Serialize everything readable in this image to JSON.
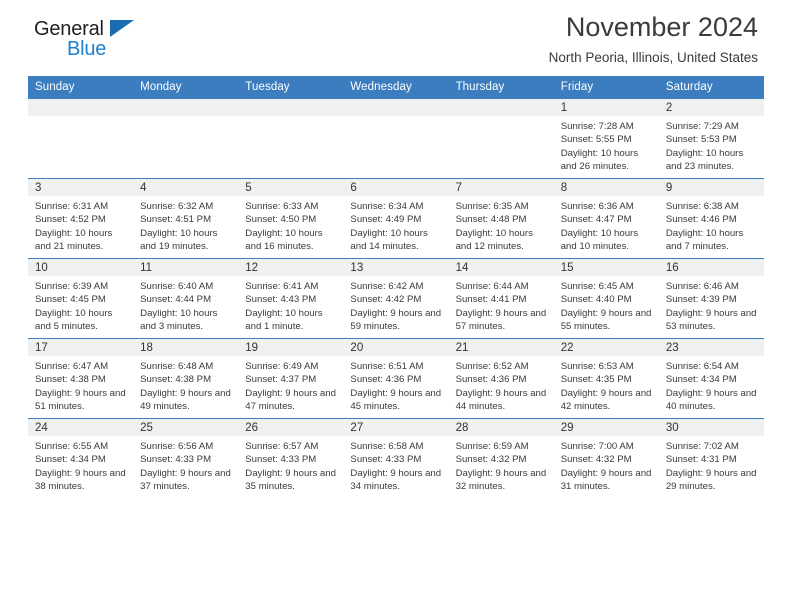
{
  "brand": {
    "name_top": "General",
    "name_bottom": "Blue",
    "triangle_color": "#1b6cb3",
    "blue_text_color": "#1b7fd4"
  },
  "header": {
    "title": "November 2024",
    "subtitle": "North Peoria, Illinois, United States"
  },
  "theme": {
    "header_row_bg": "#3b7dbf",
    "header_row_text": "#ffffff",
    "daynum_band_bg": "#f0f0f0",
    "row_border": "#3b7dbf",
    "body_text": "#3a3a3a"
  },
  "columns": [
    "Sunday",
    "Monday",
    "Tuesday",
    "Wednesday",
    "Thursday",
    "Friday",
    "Saturday"
  ],
  "labels": {
    "sunrise": "Sunrise:",
    "sunset": "Sunset:",
    "daylight": "Daylight:"
  },
  "weeks": [
    [
      {
        "day": "",
        "empty": true
      },
      {
        "day": "",
        "empty": true
      },
      {
        "day": "",
        "empty": true
      },
      {
        "day": "",
        "empty": true
      },
      {
        "day": "",
        "empty": true
      },
      {
        "day": "1",
        "sunrise": "Sunrise: 7:28 AM",
        "sunset": "Sunset: 5:55 PM",
        "daylight": "Daylight: 10 hours and 26 minutes."
      },
      {
        "day": "2",
        "sunrise": "Sunrise: 7:29 AM",
        "sunset": "Sunset: 5:53 PM",
        "daylight": "Daylight: 10 hours and 23 minutes."
      }
    ],
    [
      {
        "day": "3",
        "sunrise": "Sunrise: 6:31 AM",
        "sunset": "Sunset: 4:52 PM",
        "daylight": "Daylight: 10 hours and 21 minutes."
      },
      {
        "day": "4",
        "sunrise": "Sunrise: 6:32 AM",
        "sunset": "Sunset: 4:51 PM",
        "daylight": "Daylight: 10 hours and 19 minutes."
      },
      {
        "day": "5",
        "sunrise": "Sunrise: 6:33 AM",
        "sunset": "Sunset: 4:50 PM",
        "daylight": "Daylight: 10 hours and 16 minutes."
      },
      {
        "day": "6",
        "sunrise": "Sunrise: 6:34 AM",
        "sunset": "Sunset: 4:49 PM",
        "daylight": "Daylight: 10 hours and 14 minutes."
      },
      {
        "day": "7",
        "sunrise": "Sunrise: 6:35 AM",
        "sunset": "Sunset: 4:48 PM",
        "daylight": "Daylight: 10 hours and 12 minutes."
      },
      {
        "day": "8",
        "sunrise": "Sunrise: 6:36 AM",
        "sunset": "Sunset: 4:47 PM",
        "daylight": "Daylight: 10 hours and 10 minutes."
      },
      {
        "day": "9",
        "sunrise": "Sunrise: 6:38 AM",
        "sunset": "Sunset: 4:46 PM",
        "daylight": "Daylight: 10 hours and 7 minutes."
      }
    ],
    [
      {
        "day": "10",
        "sunrise": "Sunrise: 6:39 AM",
        "sunset": "Sunset: 4:45 PM",
        "daylight": "Daylight: 10 hours and 5 minutes."
      },
      {
        "day": "11",
        "sunrise": "Sunrise: 6:40 AM",
        "sunset": "Sunset: 4:44 PM",
        "daylight": "Daylight: 10 hours and 3 minutes."
      },
      {
        "day": "12",
        "sunrise": "Sunrise: 6:41 AM",
        "sunset": "Sunset: 4:43 PM",
        "daylight": "Daylight: 10 hours and 1 minute."
      },
      {
        "day": "13",
        "sunrise": "Sunrise: 6:42 AM",
        "sunset": "Sunset: 4:42 PM",
        "daylight": "Daylight: 9 hours and 59 minutes."
      },
      {
        "day": "14",
        "sunrise": "Sunrise: 6:44 AM",
        "sunset": "Sunset: 4:41 PM",
        "daylight": "Daylight: 9 hours and 57 minutes."
      },
      {
        "day": "15",
        "sunrise": "Sunrise: 6:45 AM",
        "sunset": "Sunset: 4:40 PM",
        "daylight": "Daylight: 9 hours and 55 minutes."
      },
      {
        "day": "16",
        "sunrise": "Sunrise: 6:46 AM",
        "sunset": "Sunset: 4:39 PM",
        "daylight": "Daylight: 9 hours and 53 minutes."
      }
    ],
    [
      {
        "day": "17",
        "sunrise": "Sunrise: 6:47 AM",
        "sunset": "Sunset: 4:38 PM",
        "daylight": "Daylight: 9 hours and 51 minutes."
      },
      {
        "day": "18",
        "sunrise": "Sunrise: 6:48 AM",
        "sunset": "Sunset: 4:38 PM",
        "daylight": "Daylight: 9 hours and 49 minutes."
      },
      {
        "day": "19",
        "sunrise": "Sunrise: 6:49 AM",
        "sunset": "Sunset: 4:37 PM",
        "daylight": "Daylight: 9 hours and 47 minutes."
      },
      {
        "day": "20",
        "sunrise": "Sunrise: 6:51 AM",
        "sunset": "Sunset: 4:36 PM",
        "daylight": "Daylight: 9 hours and 45 minutes."
      },
      {
        "day": "21",
        "sunrise": "Sunrise: 6:52 AM",
        "sunset": "Sunset: 4:36 PM",
        "daylight": "Daylight: 9 hours and 44 minutes."
      },
      {
        "day": "22",
        "sunrise": "Sunrise: 6:53 AM",
        "sunset": "Sunset: 4:35 PM",
        "daylight": "Daylight: 9 hours and 42 minutes."
      },
      {
        "day": "23",
        "sunrise": "Sunrise: 6:54 AM",
        "sunset": "Sunset: 4:34 PM",
        "daylight": "Daylight: 9 hours and 40 minutes."
      }
    ],
    [
      {
        "day": "24",
        "sunrise": "Sunrise: 6:55 AM",
        "sunset": "Sunset: 4:34 PM",
        "daylight": "Daylight: 9 hours and 38 minutes."
      },
      {
        "day": "25",
        "sunrise": "Sunrise: 6:56 AM",
        "sunset": "Sunset: 4:33 PM",
        "daylight": "Daylight: 9 hours and 37 minutes."
      },
      {
        "day": "26",
        "sunrise": "Sunrise: 6:57 AM",
        "sunset": "Sunset: 4:33 PM",
        "daylight": "Daylight: 9 hours and 35 minutes."
      },
      {
        "day": "27",
        "sunrise": "Sunrise: 6:58 AM",
        "sunset": "Sunset: 4:33 PM",
        "daylight": "Daylight: 9 hours and 34 minutes."
      },
      {
        "day": "28",
        "sunrise": "Sunrise: 6:59 AM",
        "sunset": "Sunset: 4:32 PM",
        "daylight": "Daylight: 9 hours and 32 minutes."
      },
      {
        "day": "29",
        "sunrise": "Sunrise: 7:00 AM",
        "sunset": "Sunset: 4:32 PM",
        "daylight": "Daylight: 9 hours and 31 minutes."
      },
      {
        "day": "30",
        "sunrise": "Sunrise: 7:02 AM",
        "sunset": "Sunset: 4:31 PM",
        "daylight": "Daylight: 9 hours and 29 minutes."
      }
    ]
  ]
}
